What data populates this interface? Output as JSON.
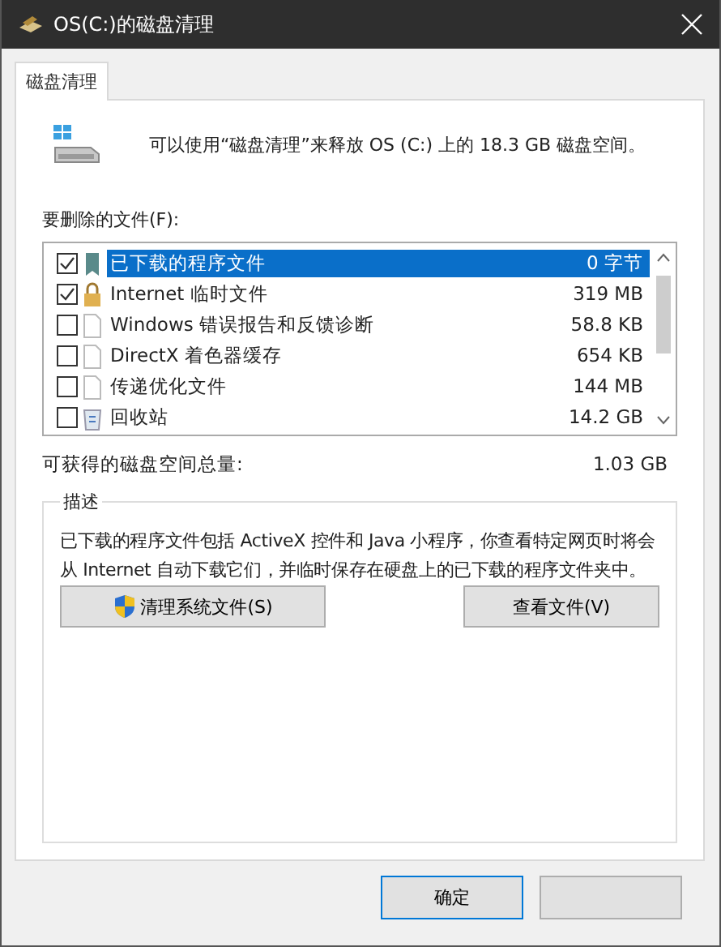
{
  "window": {
    "title": "OS(C:)的磁盘清理"
  },
  "tabs": [
    {
      "label": "磁盘清理",
      "selected": true
    }
  ],
  "summary": "可以使用“磁盘清理”来释放 OS (C:) 上的 18.3 GB 磁盘空间。",
  "files_label": "要删除的文件(F):",
  "files": [
    {
      "name": "已下载的程序文件",
      "size": "0 字节",
      "checked": true,
      "selected": true,
      "kind": "folder"
    },
    {
      "name": "Internet 临时文件",
      "size": "319 MB",
      "checked": true,
      "selected": false,
      "kind": "lock"
    },
    {
      "name": "Windows 错误报告和反馈诊断",
      "size": "58.8 KB",
      "checked": false,
      "selected": false,
      "kind": "page"
    },
    {
      "name": "DirectX 着色器缓存",
      "size": "654 KB",
      "checked": false,
      "selected": false,
      "kind": "page"
    },
    {
      "name": "传递优化文件",
      "size": "144 MB",
      "checked": false,
      "selected": false,
      "kind": "page"
    },
    {
      "name": "回收站",
      "size": "14.2 GB",
      "checked": false,
      "selected": false,
      "kind": "bin"
    }
  ],
  "total": {
    "label": "可获得的磁盘空间总量:",
    "value": "1.03 GB"
  },
  "description": {
    "title": "描述",
    "text": "已下载的程序文件包括 ActiveX 控件和 Java 小程序，你查看特定网页时将会从 Internet 自动下载它们，并临时保存在硬盘上的已下载的程序文件夹中。"
  },
  "actions": [
    {
      "label": "清理系统文件(S)",
      "kind": "shield"
    },
    {
      "label": "查看文件(V)",
      "kind": "plain"
    }
  ],
  "buttons": [
    "确定"
  ]
}
